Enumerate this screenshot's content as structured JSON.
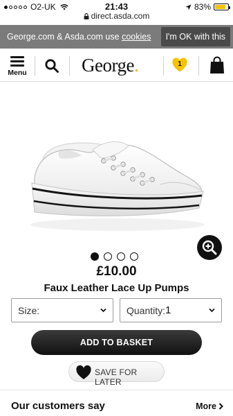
{
  "status_bar": {
    "carrier": "O2-UK",
    "time": "21:43",
    "battery": "83%",
    "battery_level": 0.83,
    "icons": [
      "signal-dots-icon",
      "wifi-icon",
      "location-arrow-icon",
      "battery-icon"
    ]
  },
  "browser": {
    "url": "direct.asda.com"
  },
  "cookie_banner": {
    "text": "George.com & Asda.com use ",
    "link": "cookies",
    "button": "I'm OK with this"
  },
  "header": {
    "menu_label": "Menu",
    "logo_text": "George",
    "logo_dot": ".",
    "favourites_count": "1",
    "accent_color": "#f0b400",
    "icons": [
      "menu-icon",
      "search-icon",
      "heart-icon",
      "basket-icon"
    ]
  },
  "product": {
    "image_description_icon": "white-lace-up-trainer-image",
    "carousel": {
      "count": 4,
      "active_index": 0
    },
    "price": "£10.00",
    "title": "Faux Leather Lace Up Pumps"
  },
  "options": {
    "size_label": "Size:",
    "size_value": "",
    "quantity_label": "Quantity:",
    "quantity_value": "1"
  },
  "actions": {
    "add_to_basket": "ADD TO BASKET",
    "save_for_later": "SAVE FOR LATER"
  },
  "reviews": {
    "title": "Our customers say",
    "more": "More"
  }
}
